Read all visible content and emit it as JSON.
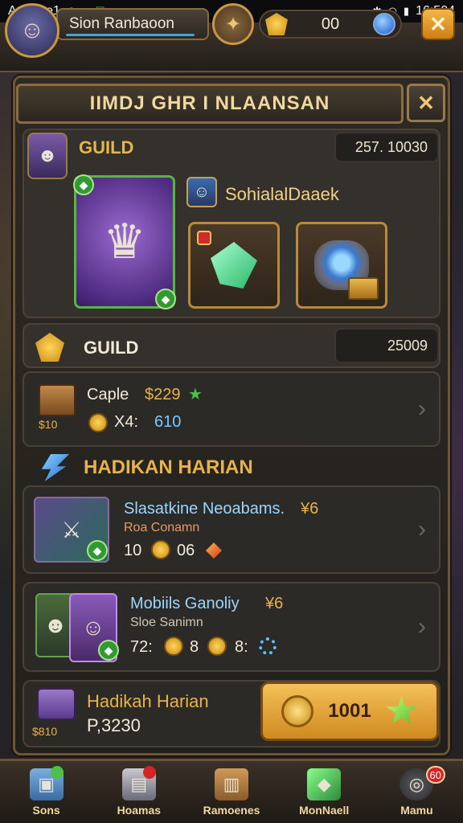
{
  "status_bar": {
    "carrier": "Antarne1",
    "time": "16:504"
  },
  "top_bar": {
    "player_name": "Sion Ranbaoon",
    "currency_value": "00"
  },
  "panel": {
    "title": "IIMDJ GHR I NLAANSAN"
  },
  "guild_card": {
    "label": "GUILD",
    "value": "257. 10030",
    "feature_name": "SohialalDaaek"
  },
  "guild_row": {
    "label": "GUILD",
    "value": "25009"
  },
  "capture_row": {
    "title": "Caple",
    "price": "$229",
    "sub_a": "X4:",
    "sub_b": "610",
    "chest_label": "$10"
  },
  "section": {
    "header": "HADIKAN HARIAN"
  },
  "list_items": [
    {
      "title": "Slasatkine Neoabams.",
      "title_tag": "¥6",
      "subtitle": "Roa Conamn",
      "stat_a": "10",
      "stat_b": "06"
    },
    {
      "title": "Mobiils Ganoliy",
      "title_tag": "¥6",
      "subtitle": "Sloe Sanimn",
      "stat_a": "72:",
      "stat_b": "8",
      "stat_c": "8:"
    }
  ],
  "claim_row": {
    "title": "Hadikah Harian",
    "amount": "P,3230",
    "box_label": "$810",
    "button_value": "1001"
  },
  "bottom_nav": [
    {
      "label": "Sons",
      "icon": "cube-icon"
    },
    {
      "label": "Hoamas",
      "icon": "crate-icon"
    },
    {
      "label": "Ramoenes",
      "icon": "chest-icon"
    },
    {
      "label": "MonNaell",
      "icon": "gem-icon"
    },
    {
      "label": "Mamu",
      "icon": "target-icon",
      "badge": "60"
    }
  ],
  "colors": {
    "accent_gold": "#e8b24a",
    "panel_border": "#6b5636",
    "claim_button": "#f4c05a"
  }
}
